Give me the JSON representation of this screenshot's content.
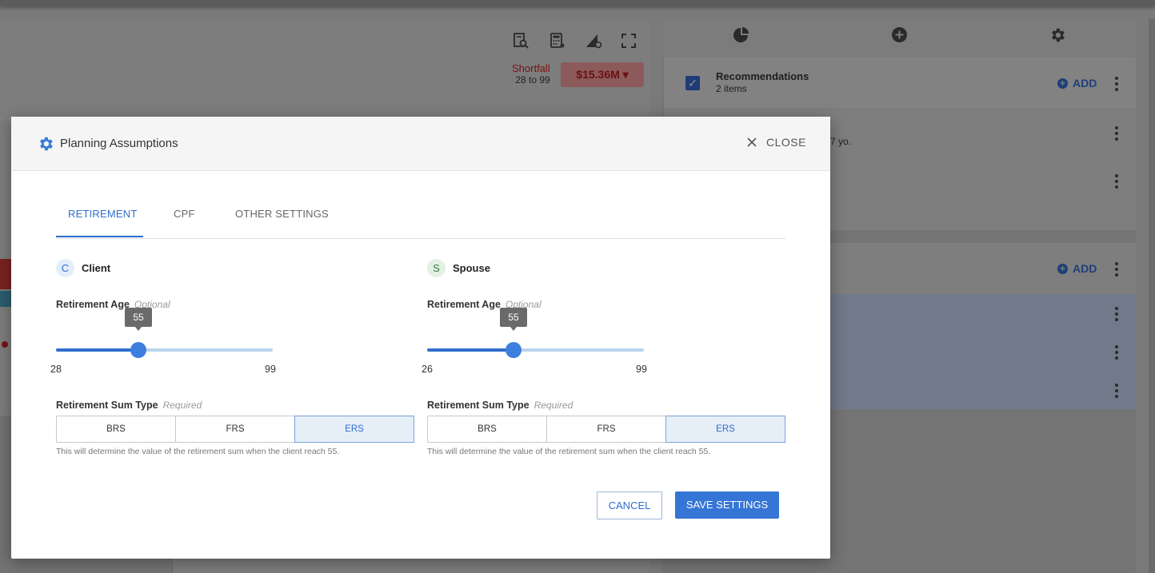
{
  "background": {
    "shortfall_label": "Shortfall",
    "shortfall_range": "28 to 99",
    "shortfall_amount": "$15.36M",
    "recommendations_title": "Recommendations",
    "recommendations_count": "2 items",
    "add_label": "ADD",
    "partial_text": "7 yo."
  },
  "modal": {
    "title": "Planning Assumptions",
    "close_label": "CLOSE",
    "tabs": [
      {
        "label": "RETIREMENT",
        "active": true
      },
      {
        "label": "CPF",
        "active": false
      },
      {
        "label": "OTHER SETTINGS",
        "active": false
      }
    ],
    "client": {
      "initial": "C",
      "name": "Client",
      "age_label": "Retirement Age",
      "age_qualifier": "Optional",
      "age_value": "55",
      "age_min": "28",
      "age_max": "99",
      "sum_label": "Retirement Sum Type",
      "sum_qualifier": "Required",
      "sum_options": [
        "BRS",
        "FRS",
        "ERS"
      ],
      "sum_selected": "ERS",
      "hint": "This will determine the value of the retirement sum when the client reach 55."
    },
    "spouse": {
      "initial": "S",
      "name": "Spouse",
      "age_label": "Retirement Age",
      "age_qualifier": "Optional",
      "age_value": "55",
      "age_min": "26",
      "age_max": "99",
      "sum_label": "Retirement Sum Type",
      "sum_qualifier": "Required",
      "sum_options": [
        "BRS",
        "FRS",
        "ERS"
      ],
      "sum_selected": "ERS",
      "hint": "This will determine the value of the retirement sum when the client reach 55."
    },
    "cancel_label": "CANCEL",
    "save_label": "SAVE SETTINGS"
  },
  "colors": {
    "accent": "#2f6fcc",
    "overlay": "#7a7a7a"
  }
}
